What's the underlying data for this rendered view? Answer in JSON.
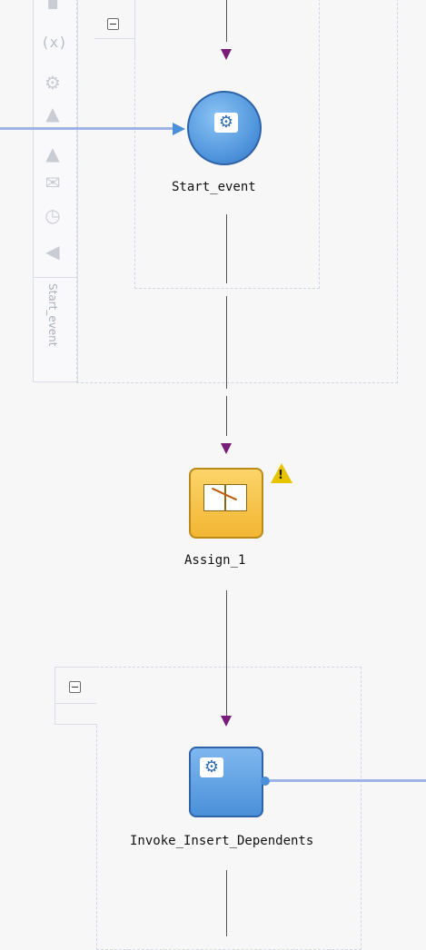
{
  "toolbar": {
    "icons": [
      "variables-icon",
      "gear-icon",
      "add-activity-icon",
      "add-activity-2-icon",
      "envelope-add-icon",
      "timer-add-icon",
      "back-add-icon"
    ],
    "variables_label": "(x)",
    "scope_label": "Start_event"
  },
  "nodes": {
    "start_event": {
      "label": "Start_event",
      "color": "#4a90d9"
    },
    "assign": {
      "label": "Assign_1",
      "color": "#f2b632",
      "warning": "!"
    },
    "invoke": {
      "label": "Invoke_Insert_Dependents",
      "color": "#4a90d9"
    }
  },
  "colors": {
    "connector": "#555555",
    "arrow_head": "#7a1c7a",
    "link": "#9fb3e6"
  }
}
